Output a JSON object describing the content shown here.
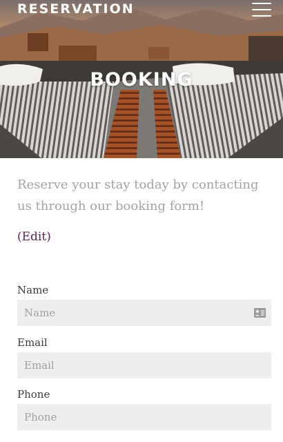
{
  "header": {
    "brand": "RESERVATION",
    "menu_icon": "hamburger-menu-icon"
  },
  "hero": {
    "title": "BOOKING"
  },
  "intro": {
    "text": "Reserve your stay today by contacting us through our booking form!",
    "edit_label": "(Edit)"
  },
  "form": {
    "name": {
      "label": "Name",
      "placeholder": "Name",
      "icon": "contact-card-icon"
    },
    "email": {
      "label": "Email",
      "placeholder": "Email"
    },
    "phone": {
      "label": "Phone",
      "placeholder": "Phone"
    }
  },
  "colors": {
    "accent": "#5b1d5a",
    "intro_text": "#a3a3a3",
    "field_bg": "#eeeeee"
  }
}
